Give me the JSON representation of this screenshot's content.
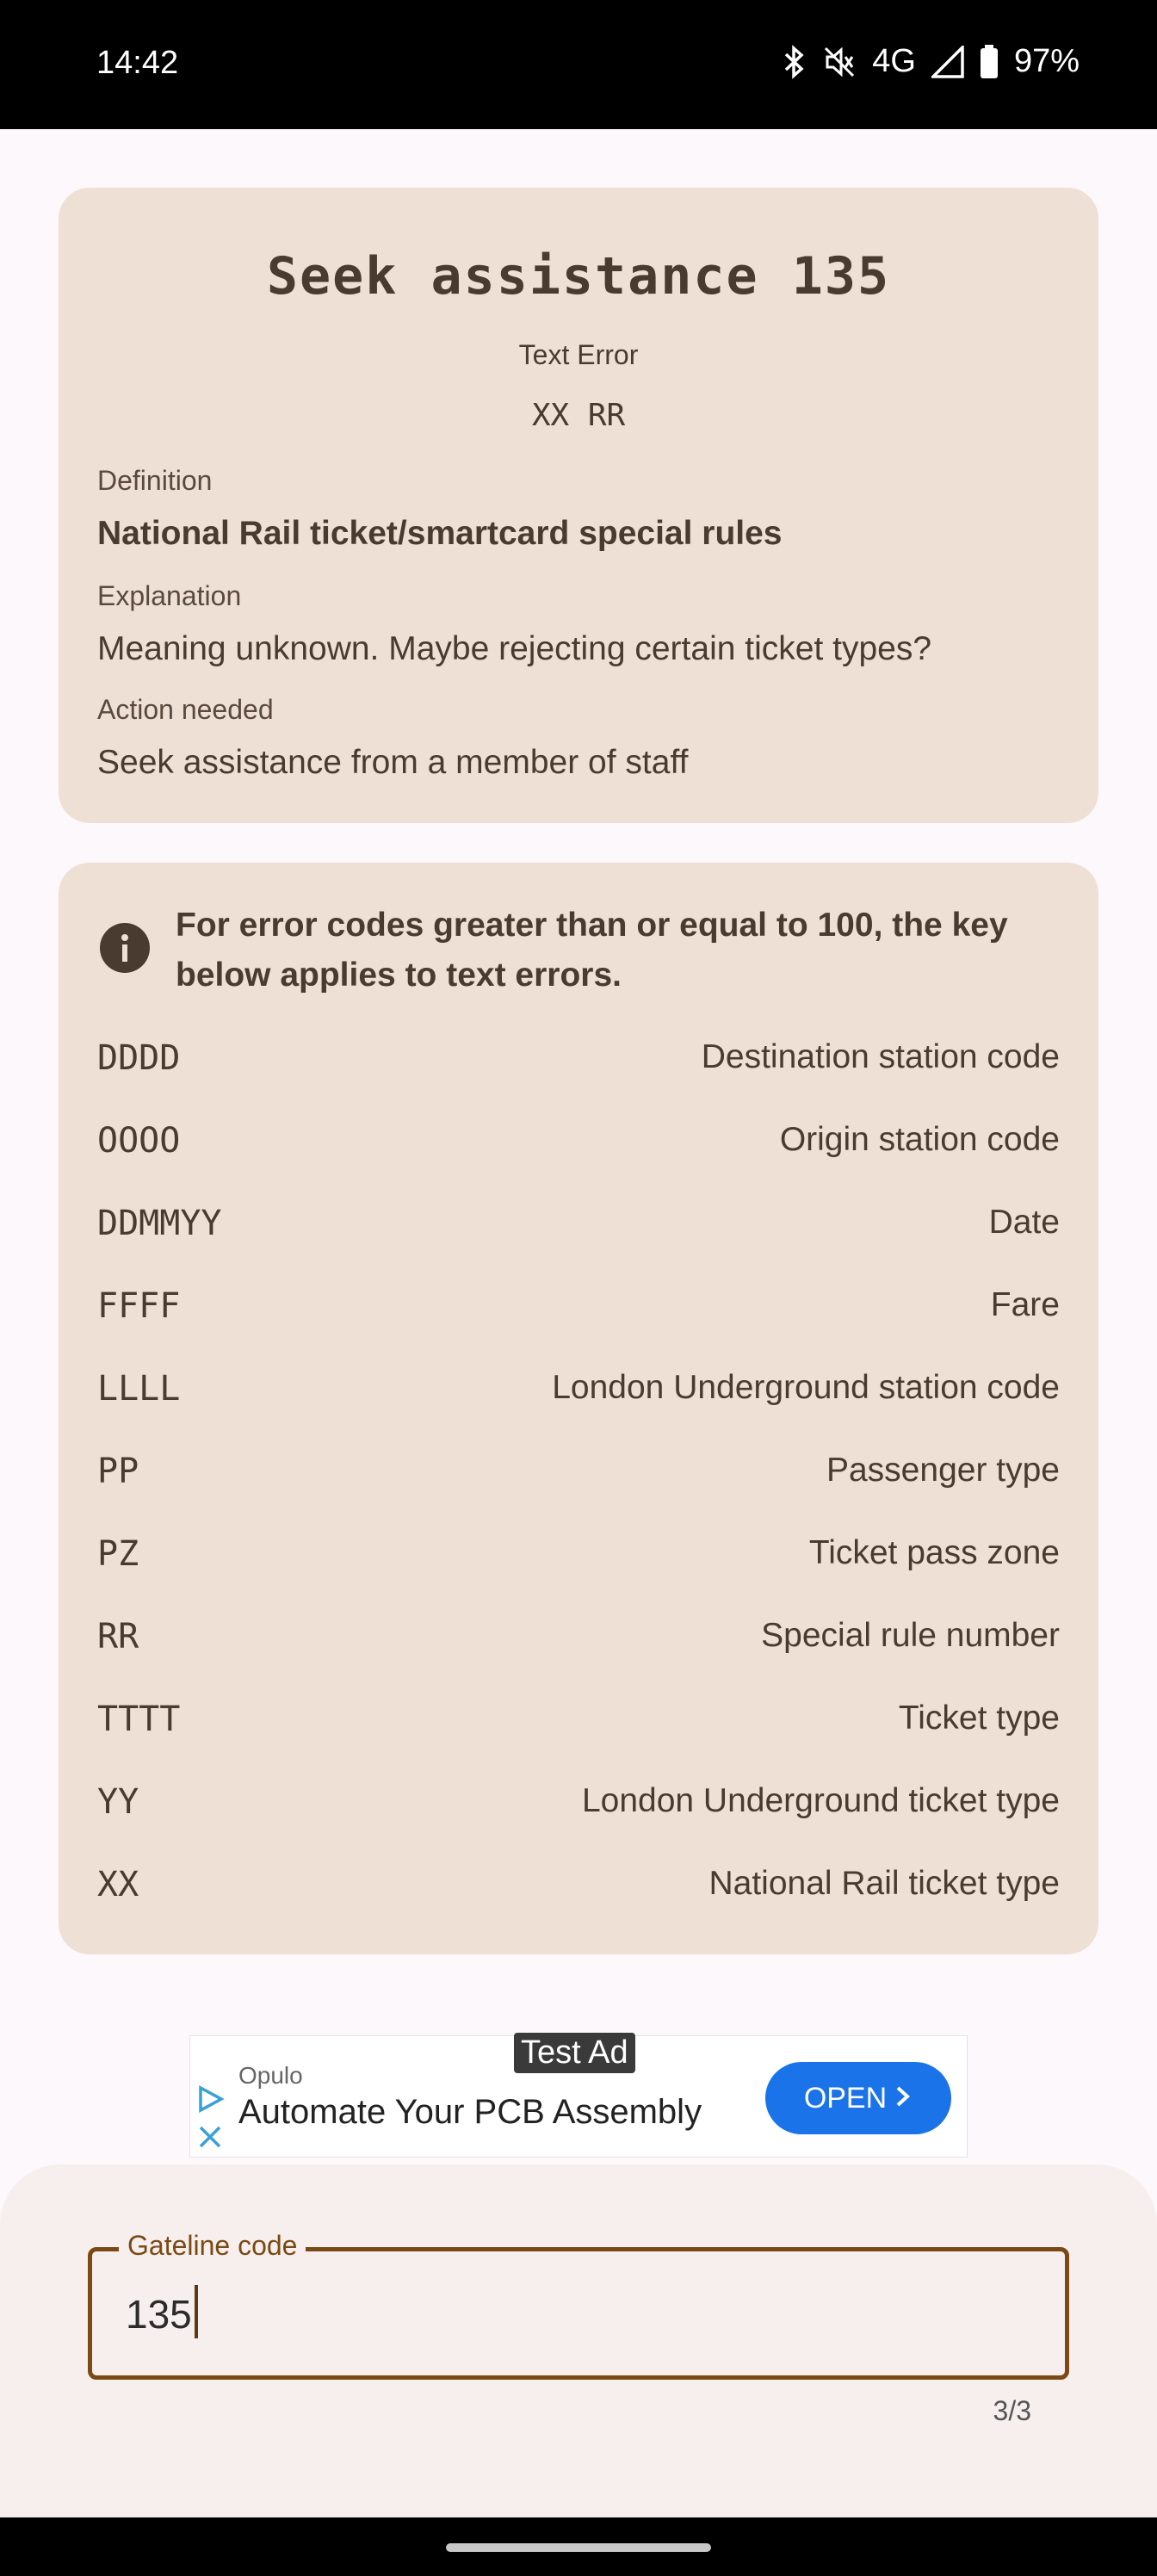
{
  "status_bar": {
    "time": "14:42",
    "network": "4G",
    "battery": "97%",
    "icons": [
      "bluetooth-icon",
      "mute-icon",
      "signal-icon",
      "battery-icon"
    ]
  },
  "error_card": {
    "title": "Seek assistance 135",
    "subtitle": "Text Error",
    "code": "XX RR",
    "definition_label": "Definition",
    "definition_value": "National Rail ticket/smartcard special rules",
    "explanation_label": "Explanation",
    "explanation_value": "Meaning unknown. Maybe rejecting certain ticket types?",
    "action_label": "Action needed",
    "action_value": "Seek assistance from a member of staff"
  },
  "key_card": {
    "info_text": "For error codes greater than or equal to 100, the key below applies to text errors.",
    "rows": [
      {
        "code": "DDDD",
        "desc": "Destination station code"
      },
      {
        "code": "OOOO",
        "desc": "Origin station code"
      },
      {
        "code": "DDMMYY",
        "desc": "Date"
      },
      {
        "code": "FFFF",
        "desc": "Fare"
      },
      {
        "code": "LLLL",
        "desc": "London Underground station code"
      },
      {
        "code": "PP",
        "desc": "Passenger type"
      },
      {
        "code": "PZ",
        "desc": "Ticket pass zone"
      },
      {
        "code": "RR",
        "desc": "Special rule number"
      },
      {
        "code": "TTTT",
        "desc": "Ticket type"
      },
      {
        "code": "YY",
        "desc": "London Underground ticket type"
      },
      {
        "code": "XX",
        "desc": "National Rail ticket type"
      }
    ]
  },
  "ad": {
    "badge": "Test Ad",
    "brand": "Opulo",
    "headline": "Automate Your PCB Assembly",
    "cta": "OPEN"
  },
  "input": {
    "label": "Gateline code",
    "value": "135",
    "counter": "3/3"
  },
  "colors": {
    "card_bg": "#efe0d5",
    "text": "#4a3b31",
    "field_border": "#7a4a15",
    "ad_button": "#1a73e8"
  }
}
